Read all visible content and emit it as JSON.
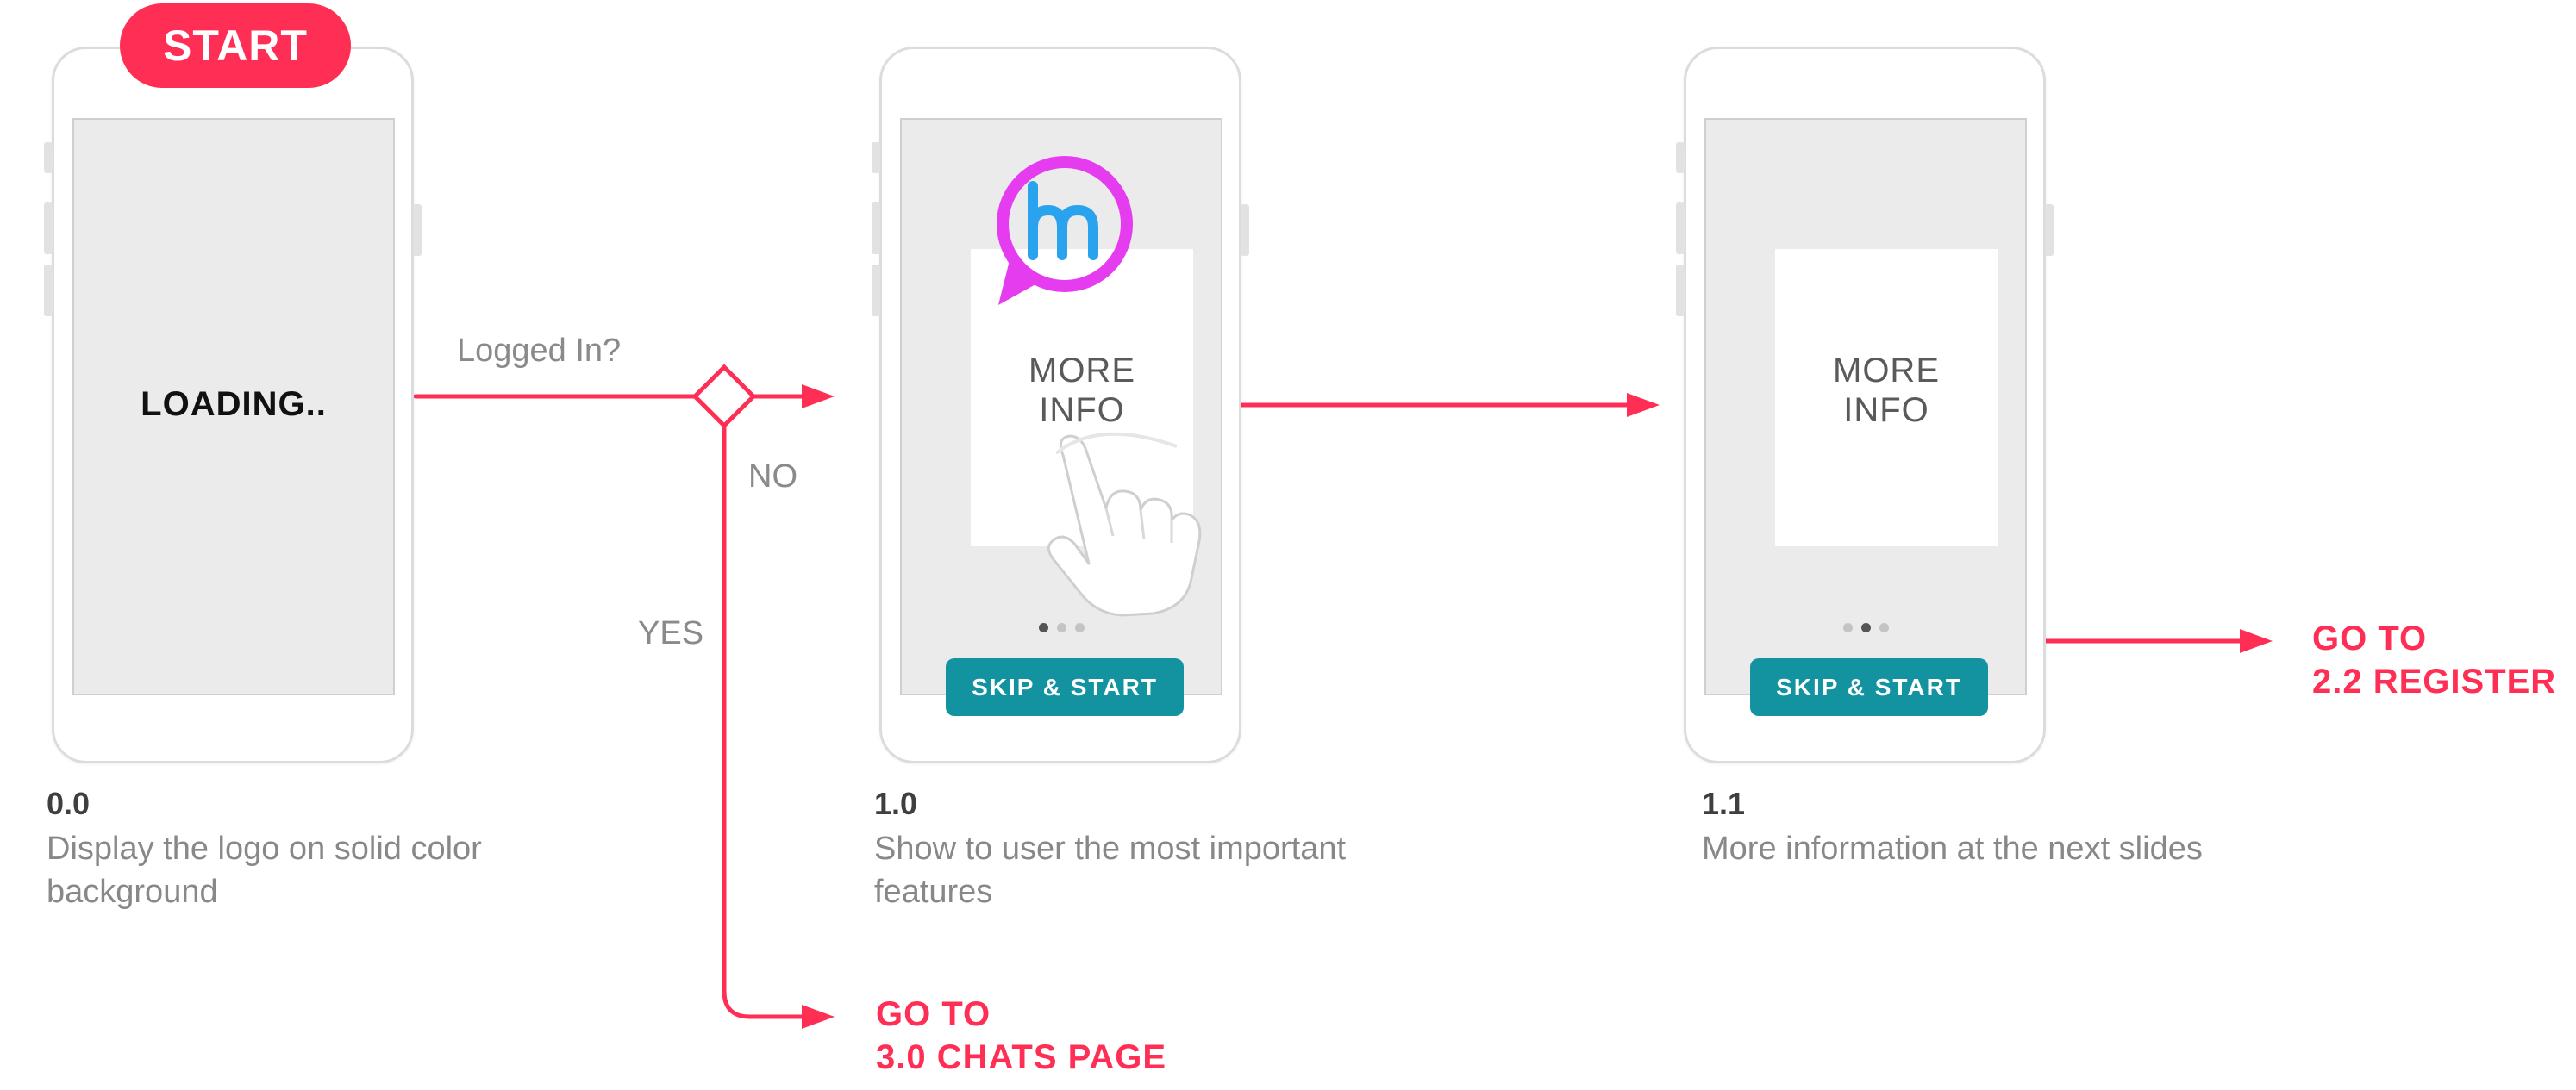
{
  "start_badge": "START",
  "decision": {
    "question": "Logged In?",
    "no_label": "NO",
    "yes_label": "YES"
  },
  "screens": [
    {
      "id": "0.0",
      "screen_text": "LOADING..",
      "description": "Display the logo on solid color background"
    },
    {
      "id": "1.0",
      "card_text": "MORE\nINFO",
      "button": "SKIP & START",
      "description": "Show to user the most important features",
      "logo_text": "hm",
      "gesture_icon": "tap-hand-icon"
    },
    {
      "id": "1.1",
      "card_text": "MORE\nINFO",
      "button": "SKIP & START",
      "description": "More information at the next slides"
    }
  ],
  "goto_chats": "GO TO\n3.0 CHATS PAGE",
  "goto_register": "GO TO\n2.2 REGISTER",
  "colors": {
    "accent": "#ff2e55",
    "button": "#12939f",
    "screen_bg": "#ebebeb",
    "logo": "#e63cf0",
    "logo_letters": "#2aa3ef"
  }
}
